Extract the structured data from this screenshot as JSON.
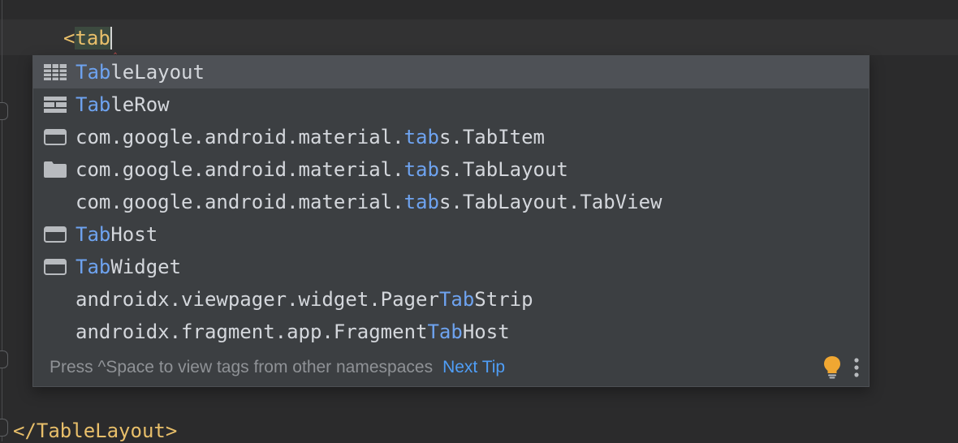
{
  "editor": {
    "typed_prefix": "<",
    "typed_text": "tab",
    "closing_tag": "</TableLayout>"
  },
  "completion": {
    "items": [
      {
        "icon": "table-layout-icon",
        "match": "Tab",
        "rest": "leLayout",
        "selected": true
      },
      {
        "icon": "table-row-icon",
        "match": "Tab",
        "rest": "leRow"
      },
      {
        "icon": "class-icon",
        "pre": "com.google.android.material.",
        "match": "tab",
        "rest": "s.TabItem"
      },
      {
        "icon": "layout-icon",
        "pre": "com.google.android.material.",
        "match": "tab",
        "rest": "s.TabLayout"
      },
      {
        "icon": "",
        "pre": "com.google.android.material.",
        "match": "tab",
        "rest": "s.TabLayout.TabView"
      },
      {
        "icon": "class-icon",
        "match": "Tab",
        "rest": "Host"
      },
      {
        "icon": "class-icon",
        "match": "Tab",
        "rest": "Widget"
      },
      {
        "icon": "",
        "pre": "androidx.viewpager.widget.Pager",
        "match": "Tab",
        "rest": "Strip"
      },
      {
        "icon": "",
        "pre": "androidx.fragment.app.Fragment",
        "match": "Tab",
        "rest": "Host"
      }
    ],
    "footer_hint": "Press ^Space to view tags from other namespaces",
    "next_tip_label": "Next Tip",
    "bulb_icon": "lightbulb-icon",
    "more_icon": "more-vertical-icon"
  },
  "colors": {
    "match_highlight": "#6ea3f0",
    "tag_text": "#e8bf6a",
    "link": "#4f9ef7",
    "bulb": "#f0a732"
  }
}
